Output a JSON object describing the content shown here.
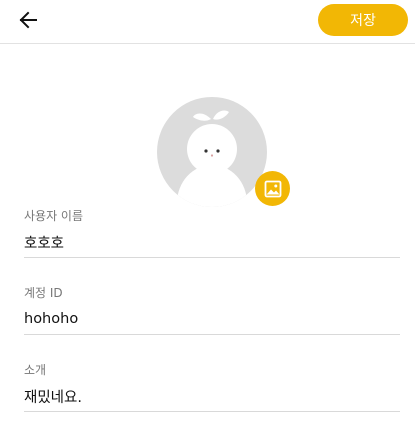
{
  "header": {
    "back_icon": "arrow-left-icon",
    "save_label": "저장"
  },
  "colors": {
    "accent": "#f2b705",
    "avatar_bg": "#dcdcdc",
    "divider": "#d9d9d9"
  },
  "profile": {
    "avatar_icon": "default-avatar-icon",
    "edit_photo_icon": "image-icon"
  },
  "fields": {
    "username": {
      "label": "사용자 이름",
      "value": "호호호"
    },
    "account_id": {
      "label": "계정 ID",
      "value": "hohoho"
    },
    "bio": {
      "label": "소개",
      "value": "재밌네요."
    }
  }
}
